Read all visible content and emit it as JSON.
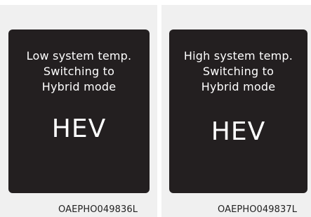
{
  "panels": [
    {
      "message": [
        "Low system temp.",
        "Switching to",
        "Hybrid mode"
      ],
      "mode": "HEV",
      "code": "OAEPHO049836L"
    },
    {
      "message": [
        "High system temp.",
        "Switching to",
        "Hybrid mode"
      ],
      "mode": "HEV",
      "code": "OAEPHO049837L"
    }
  ],
  "colors": {
    "screen_background": "#231f20",
    "panel_background": "#f0f0f0",
    "text_on_screen": "#ffffff"
  }
}
